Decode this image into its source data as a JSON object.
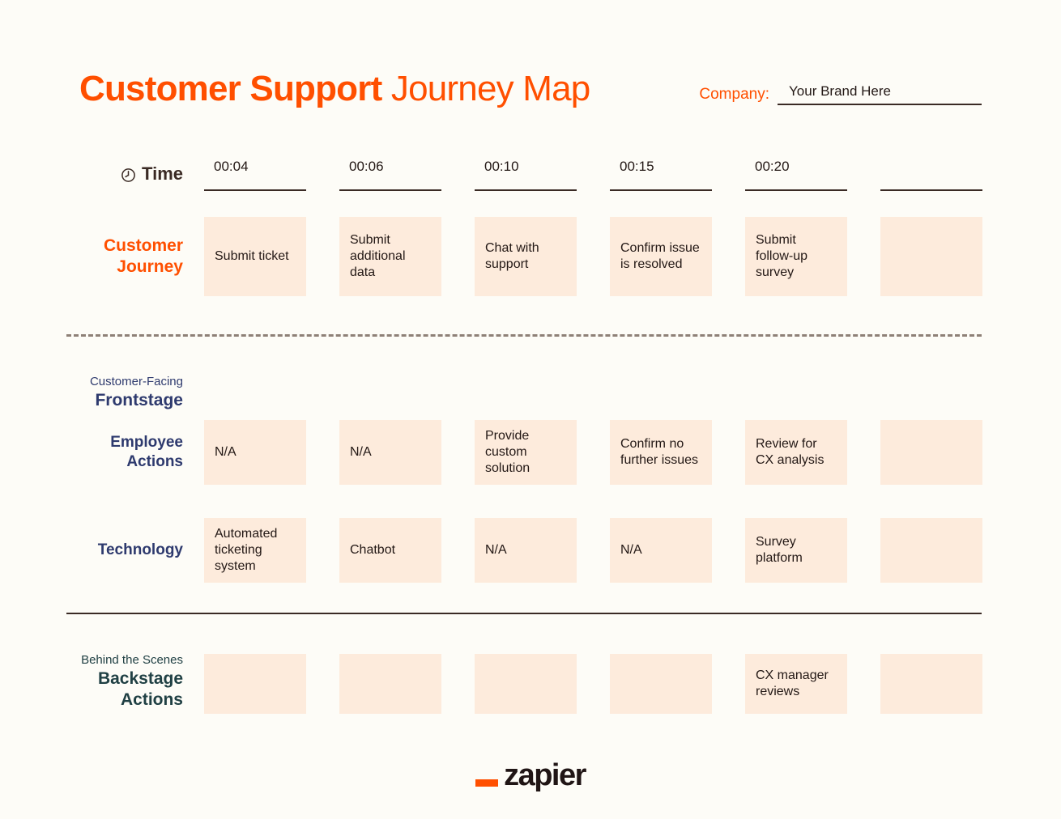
{
  "header": {
    "title_bold": "Customer Support",
    "title_light": "Journey Map",
    "company_label": "Company:",
    "company_value": "Your Brand Here",
    "company_placeholder": "Your Brand Here"
  },
  "time_row": {
    "label": "Time",
    "icon": "clock-icon",
    "values": [
      "00:04",
      "00:06",
      "00:10",
      "00:15",
      "00:20",
      ""
    ]
  },
  "rows": [
    {
      "id": "customer-journey",
      "label_line1": "Customer",
      "label_line2": "Journey",
      "cells": [
        "Submit ticket",
        "Submit additional data",
        "Chat with support",
        "Confirm issue is resolved",
        "Submit follow-up survey",
        ""
      ]
    },
    {
      "id": "employee-actions",
      "label_line1": "Employee",
      "label_line2": "Actions",
      "cells": [
        "N/A",
        "N/A",
        "Provide custom solution",
        "Confirm no further issues",
        "Review for CX analysis",
        ""
      ]
    },
    {
      "id": "technology",
      "label_line1": "Technology",
      "label_line2": "",
      "cells": [
        "Automated ticketing system",
        "Chatbot",
        "N/A",
        "N/A",
        "Survey platform",
        ""
      ]
    },
    {
      "id": "backstage-actions",
      "label_line1": "",
      "label_line2": "",
      "cells": [
        "",
        "",
        "",
        "",
        "CX manager reviews",
        ""
      ]
    }
  ],
  "sections": {
    "frontstage": {
      "kicker": "Customer-Facing",
      "name": "Frontstage"
    },
    "backstage": {
      "kicker": "Behind the Scenes",
      "name_line1": "Backstage",
      "name_line2": "Actions"
    }
  },
  "footer": {
    "logo_text": "zapier"
  },
  "colors": {
    "background": "#FDFCF7",
    "accent_orange": "#FF4F00",
    "card_peach": "#FDEBDC",
    "frontstage_navy": "#2E3A6E",
    "backstage_teal": "#204044",
    "rule_brown": "#3A2A24"
  }
}
